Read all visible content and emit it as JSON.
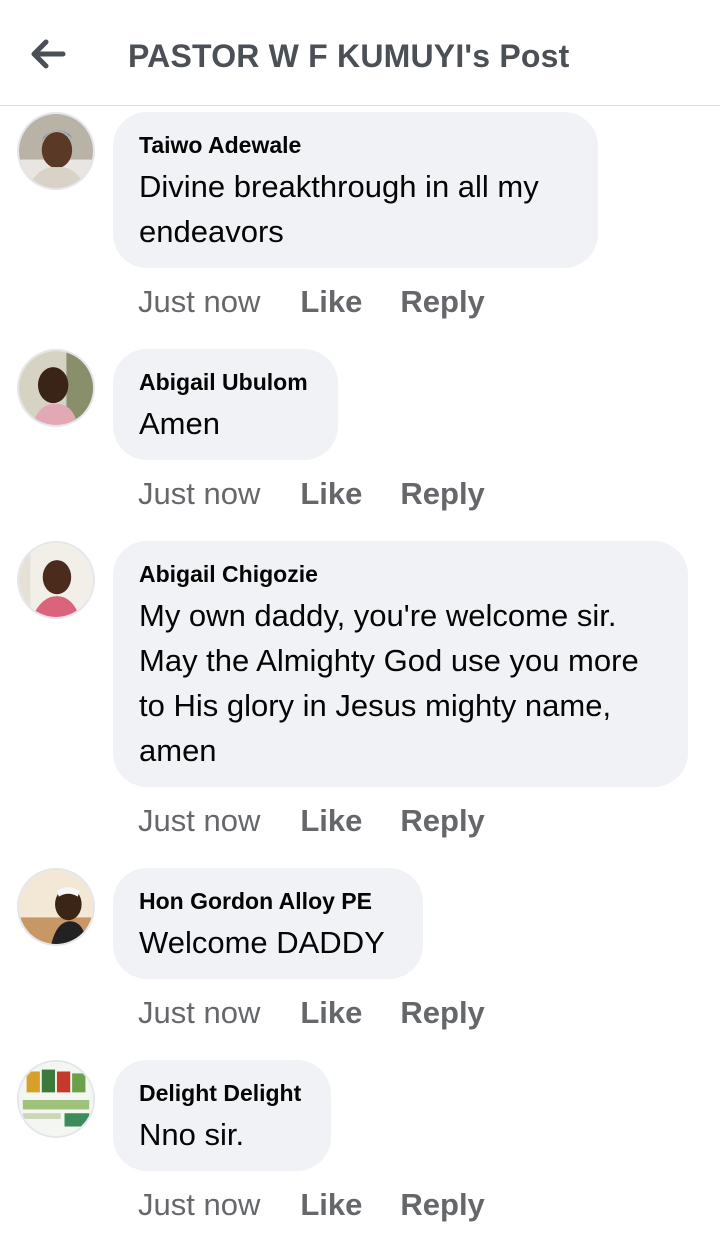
{
  "header": {
    "back_icon": "arrow-left-icon",
    "title": "PASTOR W F KUMUYI's Post"
  },
  "comments": [
    {
      "author": "Taiwo Adewale",
      "text": "Divine breakthrough in all my endeavors",
      "time": "Just now",
      "like": "Like",
      "reply": "Reply"
    },
    {
      "author": "Abigail Ubulom",
      "text": "Amen",
      "time": "Just now",
      "like": "Like",
      "reply": "Reply"
    },
    {
      "author": "Abigail Chigozie",
      "text": "My own daddy, you're welcome sir. May the Almighty God use you more to His glory in Jesus mighty name, amen",
      "time": "Just now",
      "like": "Like",
      "reply": "Reply"
    },
    {
      "author": "Hon Gordon Alloy PE",
      "text": "Welcome DADDY",
      "time": "Just now",
      "like": "Like",
      "reply": "Reply"
    },
    {
      "author": "Delight Delight",
      "text": "Nno sir.",
      "time": "Just now",
      "like": "Like",
      "reply": "Reply"
    }
  ],
  "colors": {
    "bubble": "#f0f2f5",
    "meta_text": "#65676b",
    "title_text": "#4b4f56"
  }
}
